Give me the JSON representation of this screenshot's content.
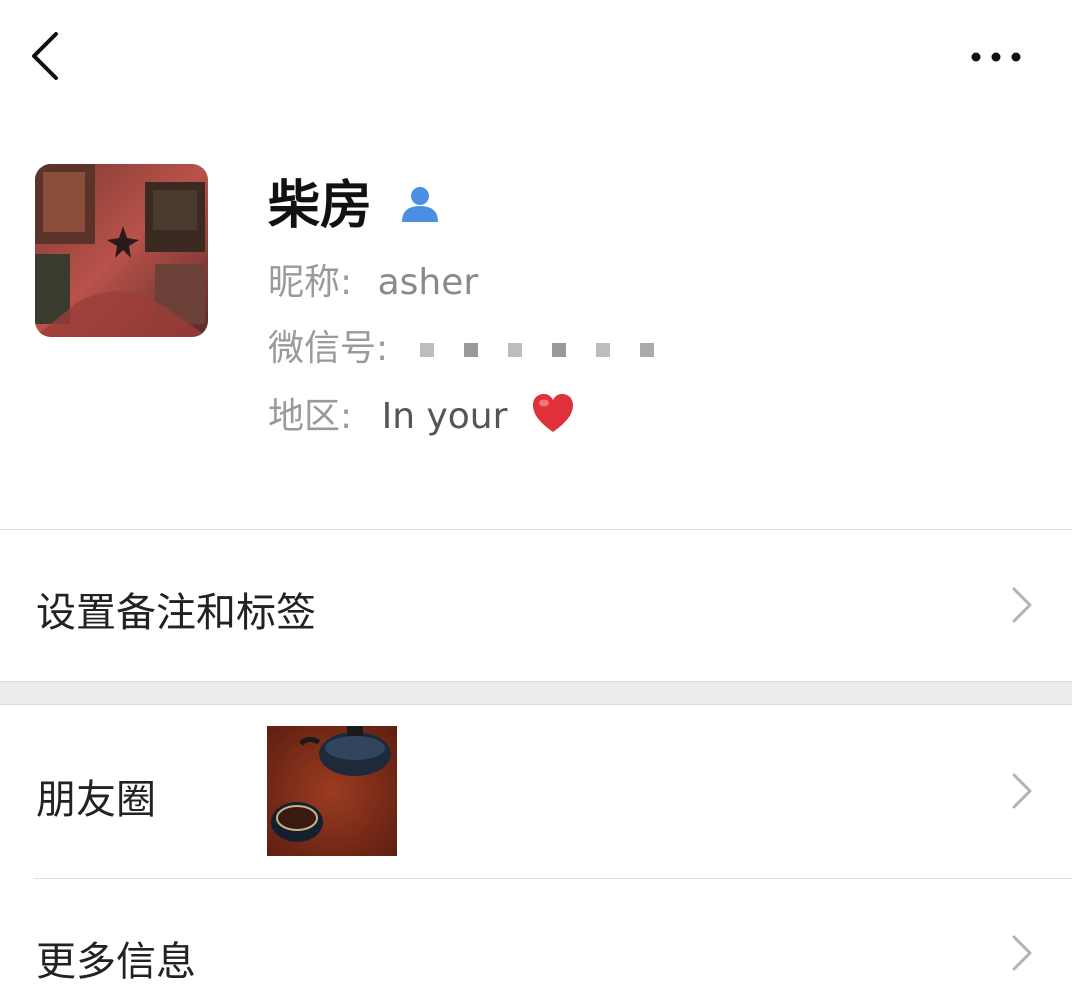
{
  "topbar": {
    "back_icon": "chevron-left-icon",
    "more_icon": "ellipsis-icon"
  },
  "profile": {
    "name": "柴房",
    "badge_icon": "contact-person-icon",
    "badge_color": "#4a90e2",
    "nickname_label": "昵称:",
    "nickname_value": "asher",
    "wechat_id_label": "微信号:",
    "wechat_id_value": "masked",
    "region_label": "地区:",
    "region_value": "In your",
    "region_emoji_icon": "red-heart-icon"
  },
  "rows": {
    "remark_tags_label": "设置备注和标签",
    "moments_label": "朋友圈",
    "more_info_label": "更多信息"
  },
  "colors": {
    "background": "#ffffff",
    "section_gap": "#ededed",
    "divider": "#dcdcdc",
    "secondary_text": "#9a9a9a"
  }
}
